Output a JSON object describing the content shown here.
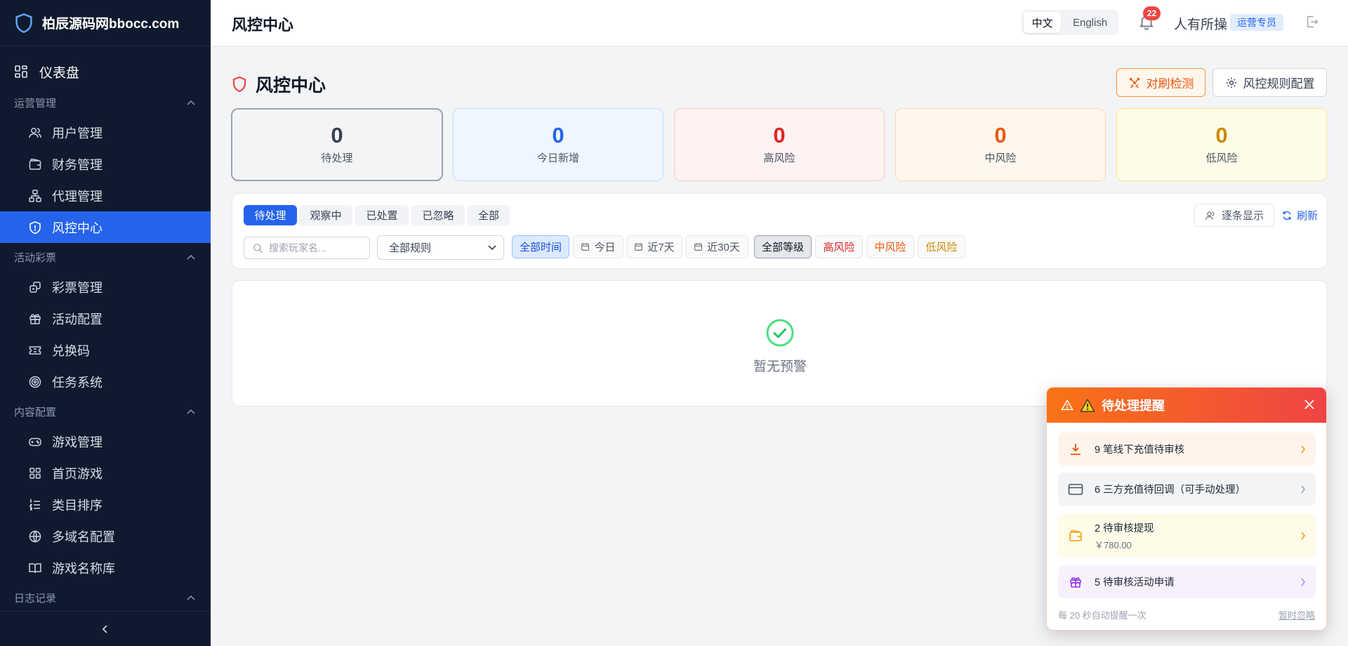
{
  "brand": {
    "name": "柏辰源码网bbocc.com"
  },
  "sidebar": {
    "top": {
      "label": "仪表盘"
    },
    "groups": [
      {
        "title": "运营管理",
        "items": [
          "用户管理",
          "财务管理",
          "代理管理",
          "风控中心"
        ]
      },
      {
        "title": "活动彩票",
        "items": [
          "彩票管理",
          "活动配置",
          "兑换码",
          "任务系统"
        ]
      },
      {
        "title": "内容配置",
        "items": [
          "游戏管理",
          "首页游戏",
          "类目排序",
          "多域名配置",
          "游戏名称库"
        ]
      },
      {
        "title": "日志记录",
        "items": []
      }
    ]
  },
  "header": {
    "title": "风控中心",
    "lang_zh": "中文",
    "lang_en": "English",
    "notification_count": "22",
    "user_name": "人有所操",
    "user_role": "运营专员"
  },
  "page": {
    "title": "风控中心",
    "btn_brush": "对刷检测",
    "btn_config": "风控规则配置"
  },
  "stats": [
    {
      "value": "0",
      "label": "待处理",
      "color": "#374151"
    },
    {
      "value": "0",
      "label": "今日新增",
      "color": "#2563eb"
    },
    {
      "value": "0",
      "label": "高风险",
      "color": "#dc2626"
    },
    {
      "value": "0",
      "label": "中风险",
      "color": "#ea580c"
    },
    {
      "value": "0",
      "label": "低风险",
      "color": "#ca8a04"
    }
  ],
  "filters": {
    "status_tabs": [
      "待处理",
      "观察中",
      "已处置",
      "已忽略",
      "全部"
    ],
    "btn_row_mode": "逐条显示",
    "btn_refresh": "刷新",
    "search_placeholder": "搜索玩家名...",
    "rule_select": "全部规则",
    "time_chips": [
      "全部时间",
      "今日",
      "近7天",
      "近30天"
    ],
    "level_chips": [
      "全部等级",
      "高风险",
      "中风险",
      "低风险"
    ]
  },
  "empty": {
    "text": "暂无预警"
  },
  "popup": {
    "title": "待处理提醒",
    "items": [
      {
        "text": "9 笔线下充值待审核"
      },
      {
        "text": "6 三方充值待回调（可手动处理）"
      },
      {
        "text": "2 待审核提现",
        "sub": "￥780.00"
      },
      {
        "text": "5 待审核活动申请"
      }
    ],
    "footer_note": "每 20 秒自动提醒一次",
    "footer_action": "暂时忽略"
  }
}
